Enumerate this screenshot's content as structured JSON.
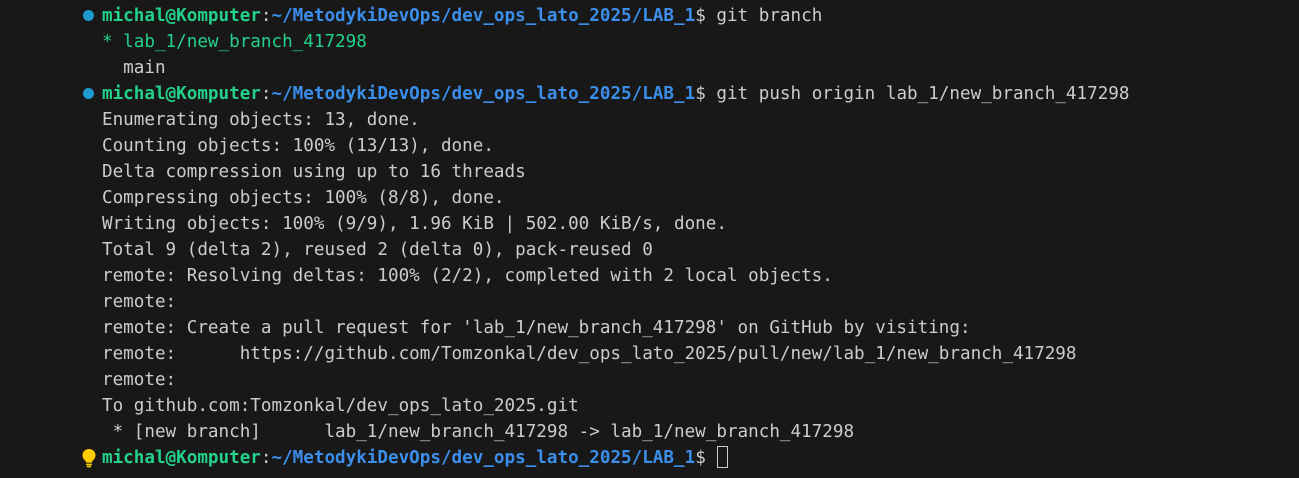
{
  "colors": {
    "background": "#181818",
    "foreground": "#cccccc",
    "user_host": "#23d18b",
    "path": "#3b8eea",
    "current_branch": "#23d18b",
    "decoration_success": "#1d9bd1",
    "lightbulb": "#ffcc00"
  },
  "prompt": {
    "user_host": "michal@Komputer",
    "separator": ":",
    "path": "~/MetodykiDevOps/dev_ops_lato_2025/LAB_1",
    "symbol": "$"
  },
  "commands": [
    "git branch",
    "git push origin lab_1/new_branch_417298",
    ""
  ],
  "branch_output": {
    "current": "* lab_1/new_branch_417298",
    "other": "  main"
  },
  "push_output": [
    "Enumerating objects: 13, done.",
    "Counting objects: 100% (13/13), done.",
    "Delta compression using up to 16 threads",
    "Compressing objects: 100% (8/8), done.",
    "Writing objects: 100% (9/9), 1.96 KiB | 502.00 KiB/s, done.",
    "Total 9 (delta 2), reused 2 (delta 0), pack-reused 0",
    "remote: Resolving deltas: 100% (2/2), completed with 2 local objects.",
    "remote: ",
    "remote: Create a pull request for 'lab_1/new_branch_417298' on GitHub by visiting:",
    "remote:      https://github.com/Tomzonkal/dev_ops_lato_2025/pull/new/lab_1/new_branch_417298",
    "remote: ",
    "To github.com:Tomzonkal/dev_ops_lato_2025.git",
    " * [new branch]      lab_1/new_branch_417298 -> lab_1/new_branch_417298"
  ],
  "icons": {
    "command_decoration": "circle-success-icon",
    "quick_fix": "lightbulb-icon"
  }
}
